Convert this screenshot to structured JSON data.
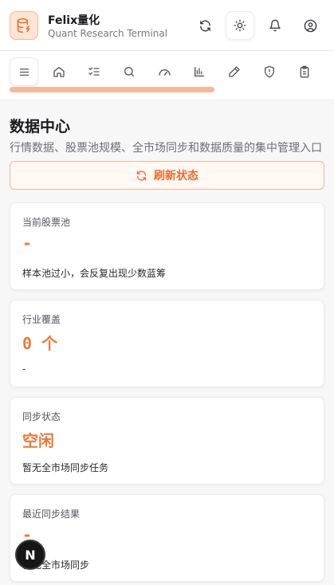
{
  "app": {
    "name": "Felix量化",
    "subtitle": "Quant Research Terminal"
  },
  "header": {
    "icons": [
      "refresh-icon",
      "sun-icon",
      "bell-icon",
      "user-circle-icon"
    ],
    "active": "sun-icon"
  },
  "nav": {
    "items": [
      "menu-icon",
      "home-icon",
      "list-check-icon",
      "search-icon",
      "gauge-icon",
      "bar-chart-icon",
      "pen-icon",
      "shield-alert-icon",
      "clipboard-icon"
    ],
    "active": "menu-icon",
    "scroll_fraction": 0.62
  },
  "page": {
    "title": "数据中心",
    "subtitle": "行情数据、股票池规模、全市场同步和数据质量的集中管理入口"
  },
  "refresh": {
    "label": "刷新状态"
  },
  "cards": [
    {
      "label": "当前股票池",
      "value": "-",
      "desc": "样本池过小，会反复出现少数蓝筹"
    },
    {
      "label": "行业覆盖",
      "value": "0 个",
      "desc": "-"
    },
    {
      "label": "同步状态",
      "value": "空闲",
      "desc": "暂无全市场同步任务"
    },
    {
      "label": "最近同步结果",
      "value": "-",
      "desc": "暂无全市场同步"
    }
  ],
  "badge": {
    "label": "N"
  },
  "colors": {
    "accent": "#ea7a3d",
    "accent_light": "#fde4d4",
    "scroll": "#f4b99a"
  }
}
